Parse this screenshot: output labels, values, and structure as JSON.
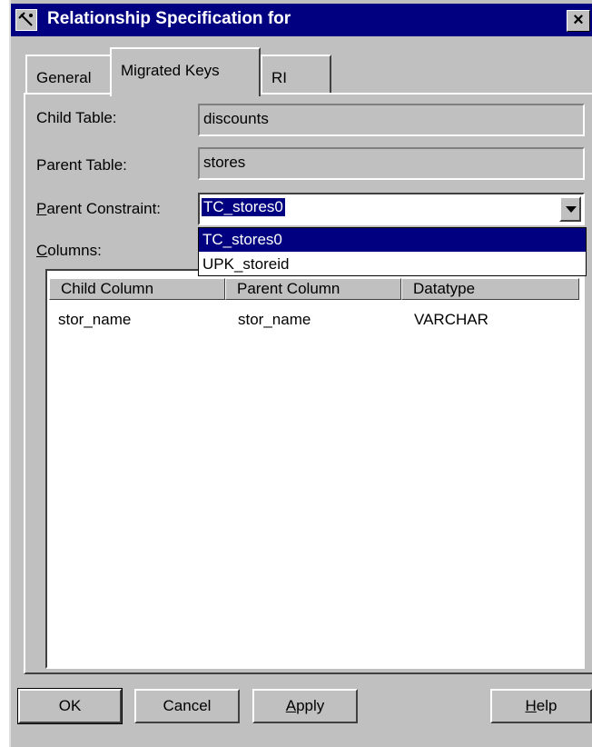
{
  "window": {
    "title": "Relationship Specification for",
    "close_symbol": "×"
  },
  "tabs": [
    {
      "label": "General",
      "active": false
    },
    {
      "label": "Migrated Keys",
      "active": true
    },
    {
      "label": "RI",
      "active": false
    }
  ],
  "form": {
    "child_table_label": "Child Table:",
    "child_table_value": "discounts",
    "parent_table_label": "Parent Table:",
    "parent_table_value": "stores",
    "parent_constraint_label_mnemonic": "P",
    "parent_constraint_label_rest": "arent Constraint:",
    "parent_constraint_value": "TC_stores0",
    "columns_label_mnemonic": "C",
    "columns_label_rest": "olumns:"
  },
  "dropdown_options": [
    {
      "label": "TC_stores0",
      "selected": true
    },
    {
      "label": "UPK_storeid",
      "selected": false
    }
  ],
  "table": {
    "headers": [
      "Child Column",
      "Parent Column",
      "Datatype"
    ],
    "rows": [
      [
        "stor_name",
        "stor_name",
        "VARCHAR"
      ]
    ]
  },
  "buttons": {
    "ok": "OK",
    "cancel": "Cancel",
    "apply_mnemonic": "A",
    "apply_rest": "pply",
    "help_mnemonic": "H",
    "help_rest": "elp"
  },
  "colors": {
    "titlebar": "#000080",
    "face": "#c0c0c0",
    "selection": "#000080"
  }
}
